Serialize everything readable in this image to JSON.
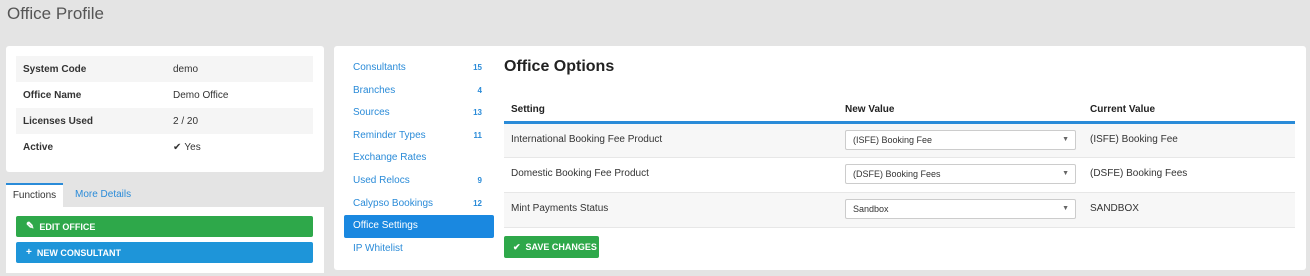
{
  "page": {
    "title": "Office Profile"
  },
  "info": {
    "rows": [
      {
        "label": "System Code",
        "value": "demo"
      },
      {
        "label": "Office Name",
        "value": "Demo Office"
      },
      {
        "label": "Licenses Used",
        "value": "2 / 20"
      },
      {
        "label": "Active",
        "value": "Yes"
      }
    ]
  },
  "tabs": {
    "functions": "Functions",
    "more_details": "More Details"
  },
  "functions": {
    "edit_office": "EDIT OFFICE",
    "new_consultant": "NEW CONSULTANT"
  },
  "nav": {
    "items": [
      {
        "label": "Consultants",
        "count": "15"
      },
      {
        "label": "Branches",
        "count": "4"
      },
      {
        "label": "Sources",
        "count": "13"
      },
      {
        "label": "Reminder Types",
        "count": "11"
      },
      {
        "label": "Exchange Rates",
        "count": ""
      },
      {
        "label": "Used Relocs",
        "count": "9"
      },
      {
        "label": "Calypso Bookings",
        "count": "12"
      },
      {
        "label": "Office Settings",
        "count": ""
      },
      {
        "label": "IP Whitelist",
        "count": ""
      }
    ],
    "selected": "Office Settings"
  },
  "options": {
    "title": "Office Options",
    "headers": {
      "setting": "Setting",
      "new_value": "New Value",
      "current_value": "Current Value"
    },
    "rows": [
      {
        "setting": "International Booking Fee Product",
        "new_value": "(ISFE) Booking Fee",
        "current_value": "(ISFE) Booking Fee"
      },
      {
        "setting": "Domestic Booking Fee Product",
        "new_value": "(DSFE) Booking Fees",
        "current_value": "(DSFE) Booking Fees"
      },
      {
        "setting": "Mint Payments Status",
        "new_value": "Sandbox",
        "current_value": "SANDBOX"
      }
    ],
    "save_label": "SAVE CHANGES"
  },
  "colors": {
    "accent": "#2a8bd8",
    "success": "#2ea84a",
    "primary_button": "#1e95d9"
  }
}
